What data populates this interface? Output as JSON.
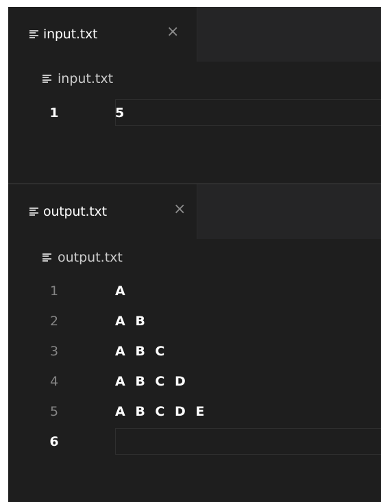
{
  "input_pane": {
    "tab": {
      "label": "input.txt",
      "close_glyph": "×"
    },
    "breadcrumb": {
      "label": "input.txt"
    },
    "lines": [
      {
        "number": "1",
        "text": "5",
        "active": true
      }
    ]
  },
  "output_pane": {
    "tab": {
      "label": "output.txt",
      "close_glyph": "×"
    },
    "breadcrumb": {
      "label": "output.txt"
    },
    "lines": [
      {
        "number": "1",
        "text": "A",
        "active": false
      },
      {
        "number": "2",
        "text": "A B",
        "active": false
      },
      {
        "number": "3",
        "text": "A B C",
        "active": false
      },
      {
        "number": "4",
        "text": "A B C D",
        "active": false
      },
      {
        "number": "5",
        "text": "A B C D E",
        "active": false
      },
      {
        "number": "6",
        "text": "",
        "active": true
      }
    ]
  },
  "icons": {
    "file": "text-file-icon",
    "close": "close-icon"
  },
  "colors": {
    "editor_bg": "#1e1e1e",
    "tabstrip_bg": "#252526",
    "line_number": "#858585",
    "active_line_number": "#ffffff"
  }
}
